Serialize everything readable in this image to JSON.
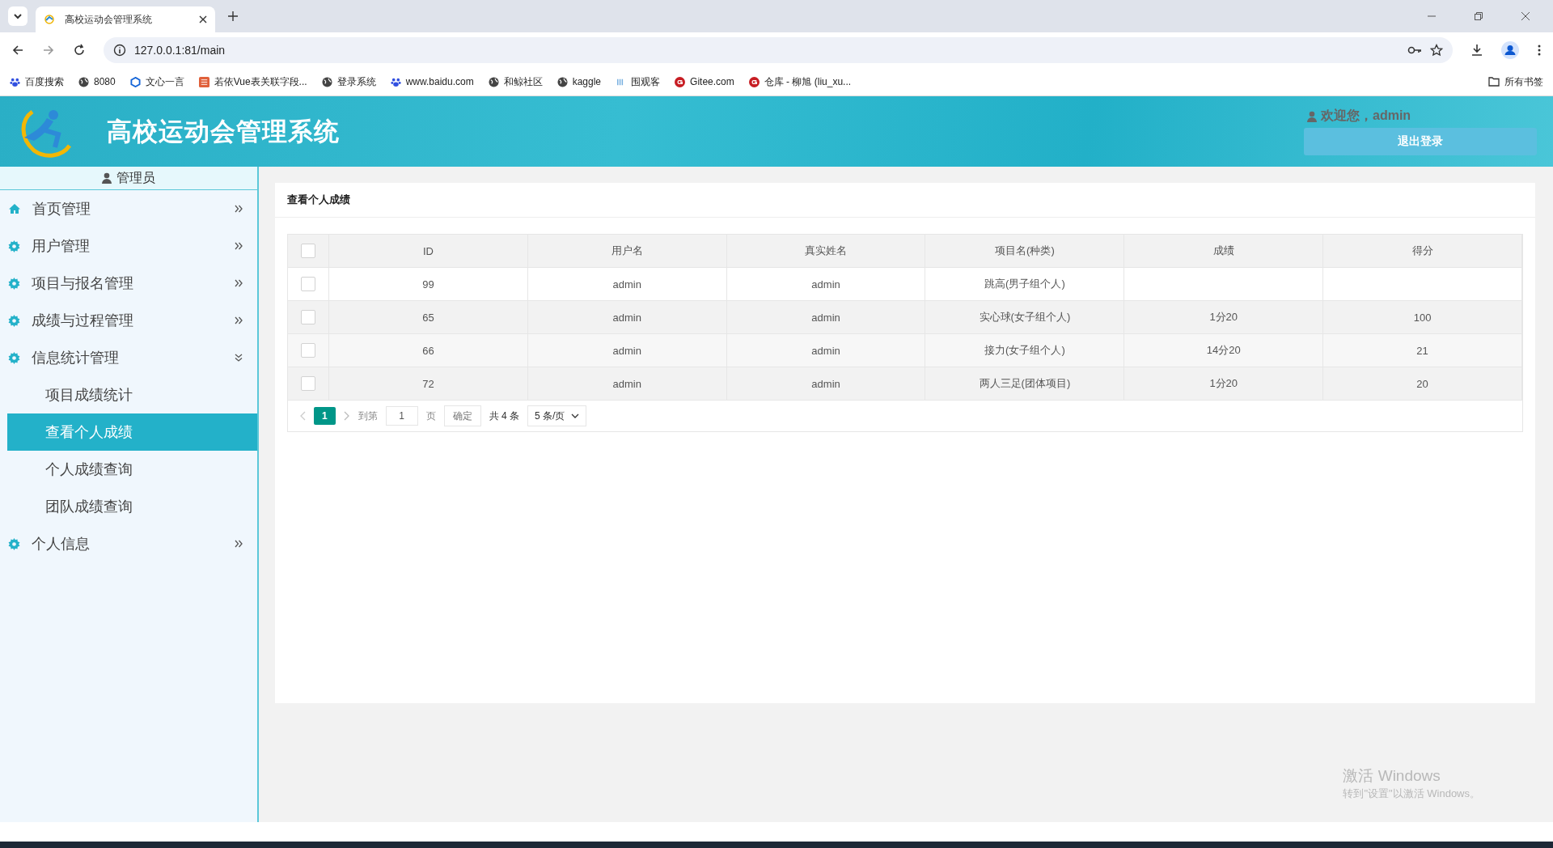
{
  "browser": {
    "tab_title": "高校运动会管理系统",
    "url": "127.0.0.1:81/main",
    "bookmarks": [
      {
        "label": "百度搜索",
        "kind": "paw"
      },
      {
        "label": "8080",
        "kind": "globe"
      },
      {
        "label": "文心一言",
        "kind": "cube"
      },
      {
        "label": "若依Vue表关联字段...",
        "kind": "square"
      },
      {
        "label": "登录系统",
        "kind": "globe"
      },
      {
        "label": "www.baidu.com",
        "kind": "paw"
      },
      {
        "label": "和鲸社区",
        "kind": "globe"
      },
      {
        "label": "kaggle",
        "kind": "globe"
      },
      {
        "label": "围观客",
        "kind": "bars"
      },
      {
        "label": "Gitee.com",
        "kind": "g"
      },
      {
        "label": "仓库 - 柳旭 (liu_xu...",
        "kind": "g"
      }
    ],
    "all_bookmarks": "所有书签"
  },
  "header": {
    "title": "高校运动会管理系统",
    "welcome": "欢迎您，admin",
    "logout": "退出登录"
  },
  "sidebar": {
    "role": "管理员",
    "items": [
      {
        "label": "首页管理",
        "kind": "home",
        "expanded": false
      },
      {
        "label": "用户管理",
        "kind": "gear",
        "expanded": false
      },
      {
        "label": "项目与报名管理",
        "kind": "gear",
        "expanded": false
      },
      {
        "label": "成绩与过程管理",
        "kind": "gear",
        "expanded": false
      },
      {
        "label": "信息统计管理",
        "kind": "gear",
        "expanded": true,
        "children": [
          {
            "label": "项目成绩统计",
            "selected": false
          },
          {
            "label": "查看个人成绩",
            "selected": true
          },
          {
            "label": "个人成绩查询",
            "selected": false
          },
          {
            "label": "团队成绩查询",
            "selected": false
          }
        ]
      },
      {
        "label": "个人信息",
        "kind": "gear",
        "expanded": false
      }
    ]
  },
  "panel": {
    "title": "查看个人成绩",
    "table": {
      "all_checked": false,
      "columns": [
        "ID",
        "用户名",
        "真实姓名",
        "项目名(种类)",
        "成绩",
        "得分"
      ],
      "rows": [
        {
          "checked": false,
          "cells": [
            "99",
            "admin",
            "admin",
            "跳高(男子组个人)",
            "",
            ""
          ]
        },
        {
          "checked": false,
          "cells": [
            "65",
            "admin",
            "admin",
            "实心球(女子组个人)",
            "1分20",
            "100"
          ]
        },
        {
          "checked": false,
          "cells": [
            "66",
            "admin",
            "admin",
            "接力(女子组个人)",
            "14分20",
            "21"
          ]
        },
        {
          "checked": false,
          "cells": [
            "72",
            "admin",
            "admin",
            "两人三足(团体项目)",
            "1分20",
            "20"
          ]
        }
      ]
    },
    "pagination": {
      "current": "1",
      "goto_label": "到第",
      "goto_value": "1",
      "page_unit": "页",
      "confirm": "确定",
      "total": "共 4 条",
      "page_size": "5 条/页"
    }
  },
  "os": {
    "activate_title": "激活 Windows",
    "activate_hint": "转到\"设置\"以激活 Windows。"
  }
}
